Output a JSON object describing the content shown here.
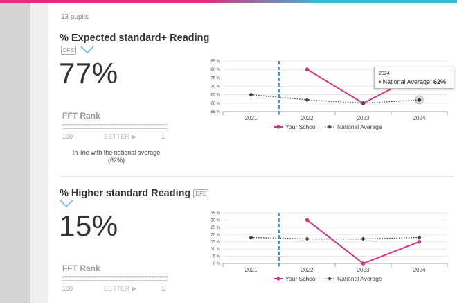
{
  "pupils": "13 pupils",
  "sections": [
    {
      "title": "% Expected standard+ Reading",
      "dfe": "DFE",
      "percent": "77%",
      "fft_title": "FFT Rank",
      "fft_low": "100",
      "fft_mid": "BETTER ▶",
      "fft_high": "1",
      "note_line1": "In line with the national average",
      "note_line2": "(62%)"
    },
    {
      "title": "% Higher standard Reading",
      "dfe": "DFE",
      "percent": "15%",
      "fft_title": "FFT Rank",
      "fft_low": "100",
      "fft_mid": "BETTER ▶",
      "fft_high": "1"
    }
  ],
  "tooltip": {
    "year": "2024",
    "label": "• National Average: ",
    "value": "62%"
  },
  "chart_data": [
    {
      "type": "line",
      "categories": [
        "2021",
        "2022",
        "2023",
        "2024"
      ],
      "yticks": [
        "85 %",
        "80 %",
        "75 %",
        "70 %",
        "65 %",
        "60 %",
        "55 %"
      ],
      "ylim": [
        55,
        85
      ],
      "series": [
        {
          "name": "Your School",
          "values": [
            null,
            80,
            60,
            77
          ],
          "color": "#d63384"
        },
        {
          "name": "National Average",
          "values": [
            65,
            62,
            60,
            62
          ],
          "color": "#444444"
        }
      ],
      "legend": "bottom"
    },
    {
      "type": "line",
      "categories": [
        "2021",
        "2022",
        "2023",
        "2024"
      ],
      "yticks": [
        "35 %",
        "30 %",
        "25 %",
        "20 %",
        "15 %",
        "10 %",
        "5 %",
        "0 %"
      ],
      "ylim": [
        0,
        35
      ],
      "series": [
        {
          "name": "Your School",
          "values": [
            null,
            30,
            0,
            15
          ],
          "color": "#d63384"
        },
        {
          "name": "National Average",
          "values": [
            18,
            17,
            17,
            18
          ],
          "color": "#444444"
        }
      ],
      "legend": "bottom"
    }
  ]
}
